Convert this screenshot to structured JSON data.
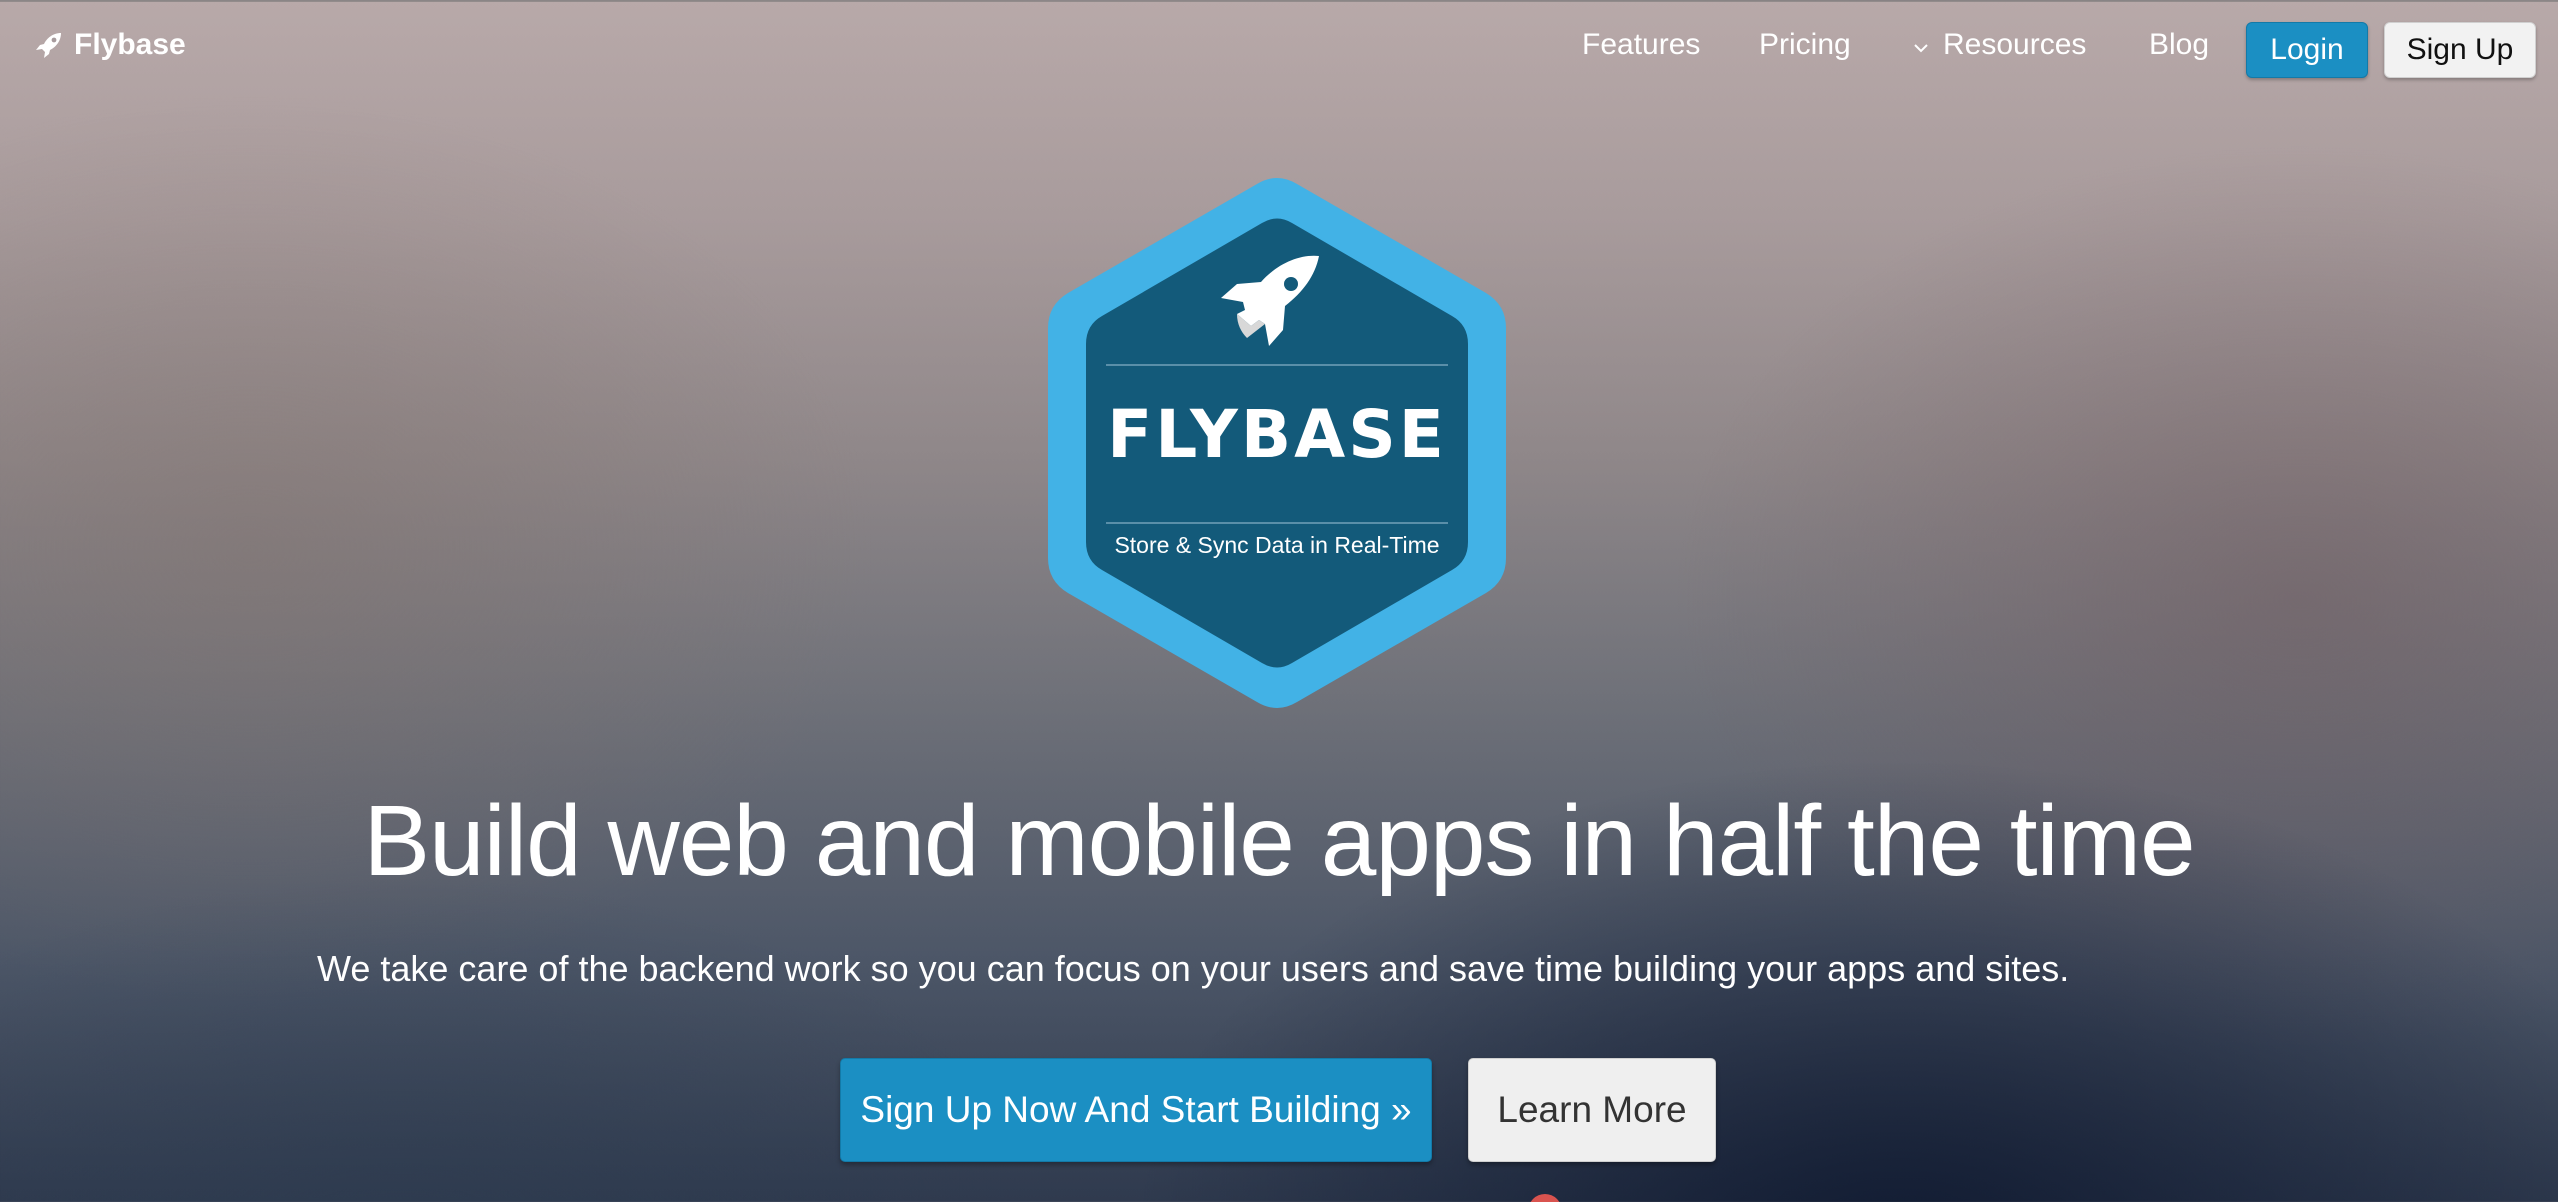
{
  "navbar": {
    "brand": {
      "name": "Flybase",
      "icon": "rocket-icon"
    },
    "links": {
      "features": "Features",
      "pricing": "Pricing",
      "resources": "Resources",
      "blog": "Blog"
    },
    "resources_icon": "chevron-down-icon",
    "login_label": "Login",
    "signup_label": "Sign Up"
  },
  "badge": {
    "icon": "rocket-icon",
    "title": "FLYBASE",
    "tagline": "Store & Sync Data in Real-Time"
  },
  "hero": {
    "heading": "Build web and mobile apps in half the time",
    "subheading": "We take care of the backend work so you can focus on your users and save time building your apps and sites.",
    "primary_cta": "Sign Up Now And Start Building »",
    "secondary_cta": "Learn More"
  },
  "colors": {
    "accent": "#1b8fc3",
    "badge_outer": "#42b2e6",
    "badge_inner": "#135a7a",
    "light_button": "#efefef"
  }
}
